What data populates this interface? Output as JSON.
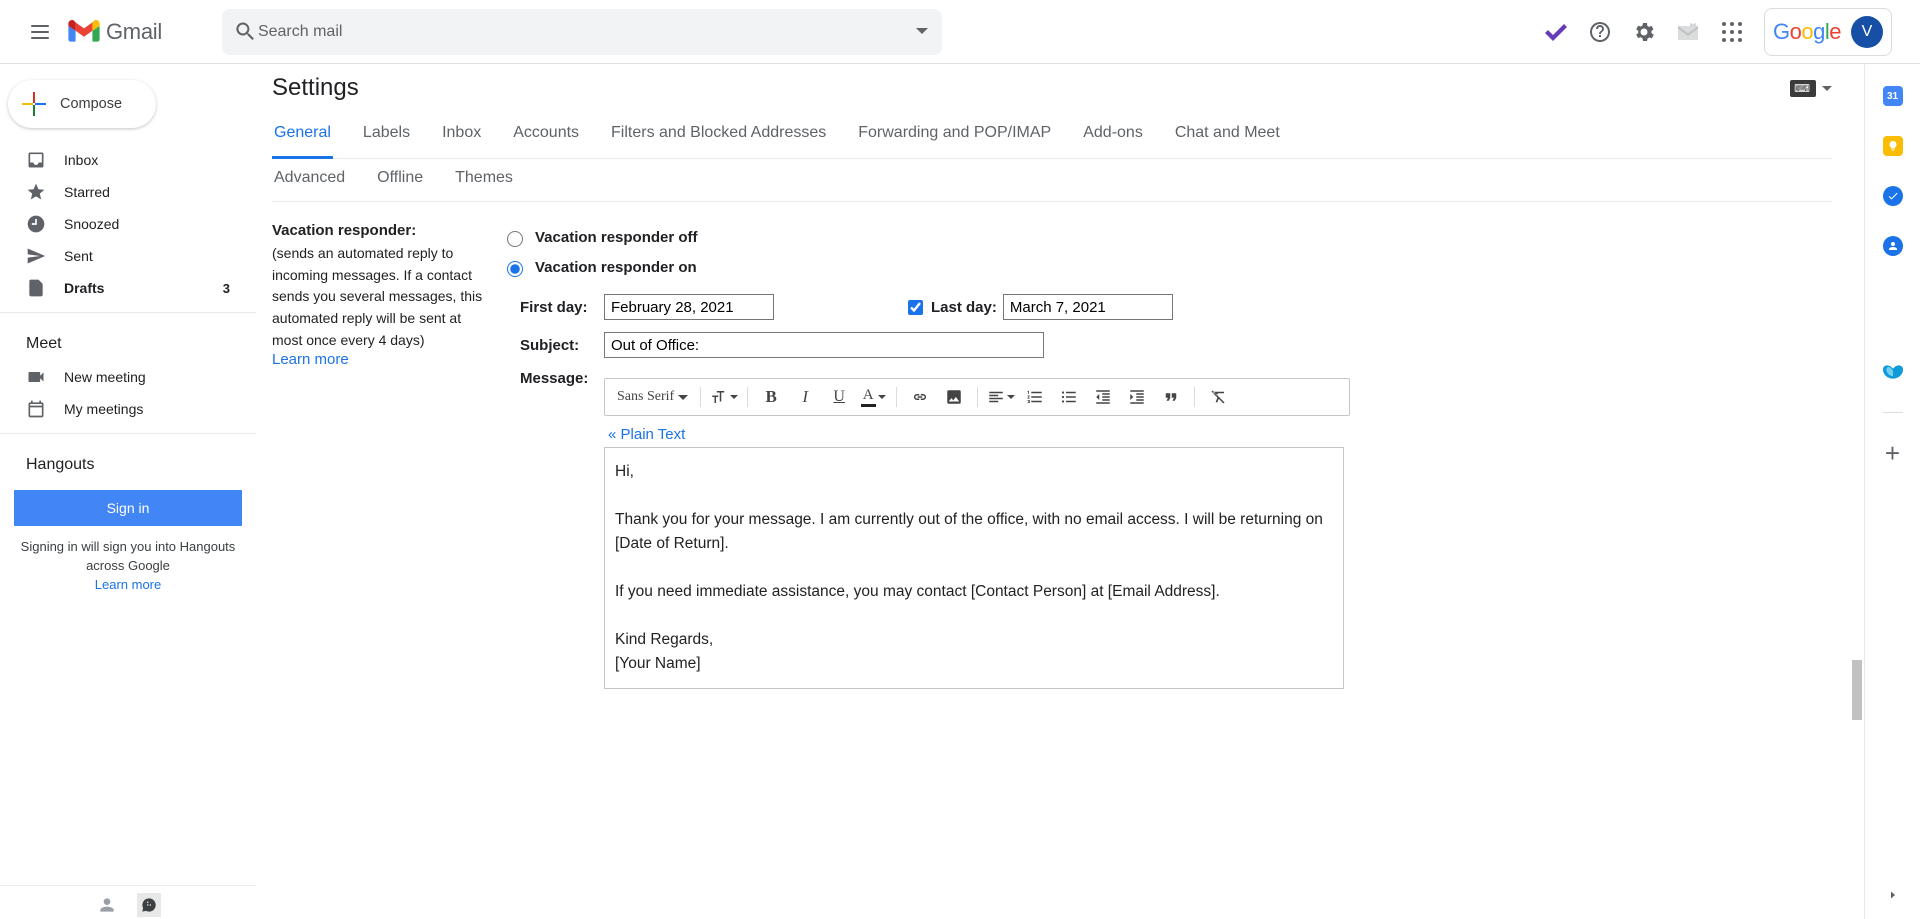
{
  "header": {
    "search_placeholder": "Search mail",
    "account_initial": "V",
    "gmail_label": "Gmail"
  },
  "compose_label": "Compose",
  "nav": {
    "inbox": "Inbox",
    "starred": "Starred",
    "snoozed": "Snoozed",
    "sent": "Sent",
    "drafts": "Drafts",
    "drafts_count": "3"
  },
  "meet": {
    "header": "Meet",
    "new": "New meeting",
    "my": "My meetings"
  },
  "hangouts": {
    "header": "Hangouts",
    "signin": "Sign in",
    "note": "Signing in will sign you into Hangouts across Google",
    "learn": "Learn more"
  },
  "settings": {
    "title": "Settings",
    "tabs_row1": [
      "General",
      "Labels",
      "Inbox",
      "Accounts",
      "Filters and Blocked Addresses",
      "Forwarding and POP/IMAP",
      "Add-ons",
      "Chat and Meet"
    ],
    "tabs_row2": [
      "Advanced",
      "Offline",
      "Themes"
    ],
    "active_tab": "General"
  },
  "vr": {
    "label": "Vacation responder:",
    "desc": "(sends an automated reply to incoming messages. If a contact sends you several messages, this automated reply will be sent at most once every 4 days)",
    "learn": "Learn more",
    "off": "Vacation responder off",
    "on": "Vacation responder on",
    "firstday_label": "First day:",
    "firstday_value": "February 28, 2021",
    "lastday_label": "Last day:",
    "lastday_value": "March 7, 2021",
    "subject_label": "Subject:",
    "subject_value": "Out of Office:",
    "message_label": "Message:",
    "font_name": "Sans Serif",
    "plain_text": "« Plain Text",
    "body": "Hi,\n\nThank you for your message. I am currently out of the office, with no email access. I will be returning on [Date of Return].\n\nIf you need immediate assistance, you may contact [Contact Person] at [Email Address].\n\nKind Regards,\n[Your Name]"
  },
  "sidepanel": {
    "calendar_day": "31"
  }
}
